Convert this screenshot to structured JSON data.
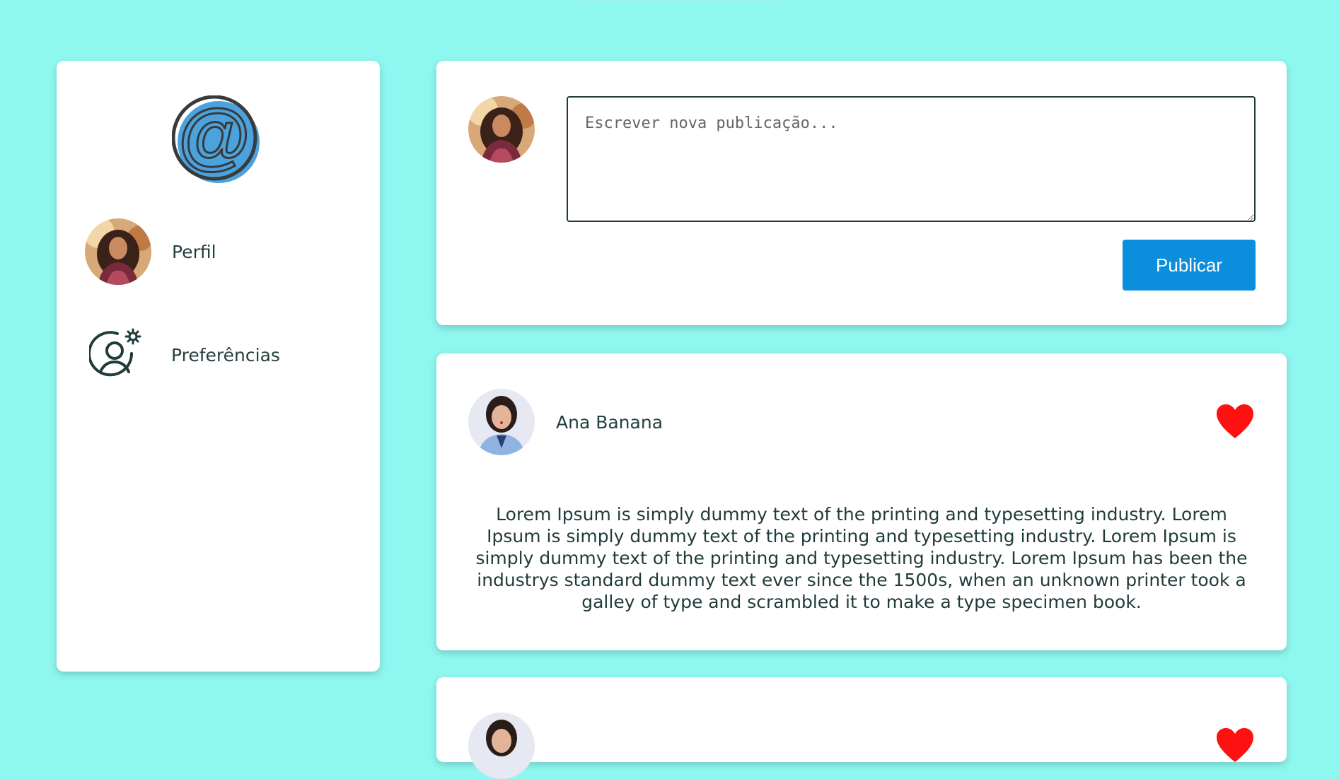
{
  "sidebar": {
    "logo": "at-sign-logo",
    "items": [
      {
        "label": "Perfil",
        "icon": "user-avatar"
      },
      {
        "label": "Preferências",
        "icon": "user-settings-icon"
      }
    ]
  },
  "composer": {
    "placeholder": "Escrever nova publicação...",
    "value": "",
    "publish_label": "Publicar"
  },
  "posts": [
    {
      "author": "Ana Banana",
      "text": "Lorem Ipsum is simply dummy text of the printing and typesetting industry. Lorem Ipsum is simply dummy text of the printing and typesetting industry. Lorem Ipsum is simply dummy text of the printing and typesetting industry. Lorem Ipsum has been the industrys standard dummy text ever since the 1500s, when an unknown printer took a galley of type and scrambled it to make a type specimen book.",
      "liked": true
    }
  ],
  "colors": {
    "background": "#8ef7f0",
    "card": "#ffffff",
    "primary_button": "#0b8edc",
    "heart": "#ff1111",
    "text": "#1f3b3a",
    "logo_blue": "#4aa3df"
  }
}
